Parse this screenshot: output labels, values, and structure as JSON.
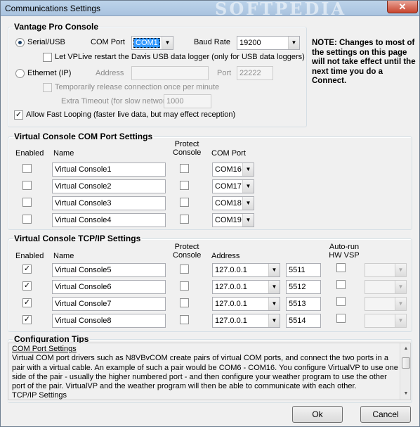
{
  "window": {
    "title": "Communications Settings",
    "watermark": "SOFTPEDIA",
    "close_glyph": "✕"
  },
  "vantage": {
    "legend": "Vantage Pro Console",
    "serial_label": "Serial/USB",
    "com_port_label": "COM Port",
    "com_port_value": "COM1",
    "baud_label": "Baud Rate",
    "baud_value": "19200",
    "restart_label": "Let VPLive restart the Davis USB data logger (only for USB data loggers)",
    "ethernet_label": "Ethernet (IP)",
    "address_label": "Address",
    "address_value": "",
    "port_label": "Port",
    "port_value": "22222",
    "temp_release_label": "Temporarily release  connection once per minute",
    "extra_timeout_label": "Extra Timeout (for slow networks)",
    "extra_timeout_value": "1000",
    "fast_loop_label": "Allow Fast Looping (faster live data, but may effect reception)"
  },
  "note": "NOTE: Changes to most of the settings on this page will not take effect until the next time you do a Connect.",
  "com_settings": {
    "legend": "Virtual Console COM Port Settings",
    "headers": {
      "enabled": "Enabled",
      "name": "Name",
      "protect": "Protect Console",
      "port": "COM Port"
    },
    "rows": [
      {
        "name": "Virtual Console1",
        "port": "COM16"
      },
      {
        "name": "Virtual Console2",
        "port": "COM17"
      },
      {
        "name": "Virtual Console3",
        "port": "COM18"
      },
      {
        "name": "Virtual Console4",
        "port": "COM19"
      }
    ]
  },
  "tcp_settings": {
    "legend": "Virtual Console TCP/IP Settings",
    "headers": {
      "enabled": "Enabled",
      "name": "Name",
      "protect": "Protect Console",
      "address": "Address",
      "autorun": "Auto-run HW VSP"
    },
    "rows": [
      {
        "name": "Virtual Console5",
        "address": "127.0.0.1",
        "port": "5511"
      },
      {
        "name": "Virtual Console6",
        "address": "127.0.0.1",
        "port": "5512"
      },
      {
        "name": "Virtual Console7",
        "address": "127.0.0.1",
        "port": "5513"
      },
      {
        "name": "Virtual Console8",
        "address": "127.0.0.1",
        "port": "5514"
      }
    ]
  },
  "tips": {
    "legend": "Configuration Tips",
    "heading": "COM Port Settings",
    "body": "Virtual COM port drivers such as N8VBvCOM create pairs of virtual COM ports, and connect the two ports in a pair with a virtual cable. An example of such a pair would be COM6 - COM16. You configure VirtualVP to use one side of the pair - usually the higher numbered port - and then configure your weather program to use the other port of the pair. VirtualVP and the weather program will then be able to communicate with each other.",
    "next_heading": "TCP/IP Settings"
  },
  "buttons": {
    "ok": "Ok",
    "cancel": "Cancel"
  },
  "glyphs": {
    "check": "✓",
    "arrow": "▼",
    "up": "▲",
    "down": "▼"
  }
}
